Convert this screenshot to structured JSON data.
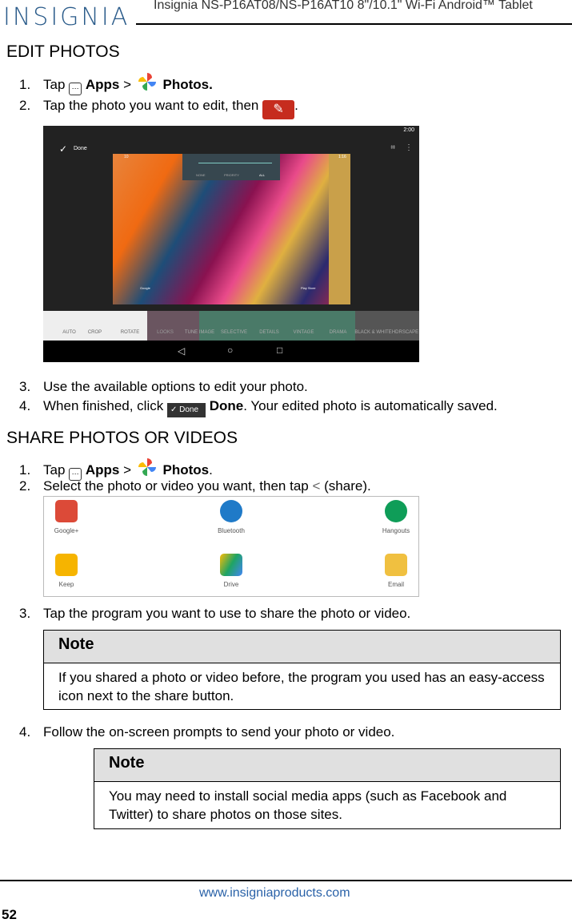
{
  "header": {
    "logo": "INSIGNIA",
    "title": "Insignia  NS-P16AT08/NS-P16AT10  8\"/10.1\" Wi-Fi Android™ Tablet"
  },
  "edit": {
    "heading": "EDIT PHOTOS",
    "steps": [
      {
        "n": "1.",
        "pre": "Tap",
        "apps": "Apps",
        ">": ">",
        "photos": "Photos."
      },
      {
        "n": "2.",
        "text": "Tap the photo you want to edit, then",
        "end": "."
      },
      {
        "n": "3.",
        "text": "Use the available options to edit your photo."
      },
      {
        "n": "4.",
        "pre": "When finished, click",
        "button": "Done",
        "bold": "Done",
        "post": ". Your edited photo is automatically saved."
      }
    ],
    "screenshot": {
      "done": "Done",
      "time": "2:00",
      "left_time": "10",
      "right_time": "1:16",
      "sound": [
        "NONE",
        "PRIORITY",
        "ALL"
      ],
      "google": "Google",
      "play": "Play Store",
      "tools": [
        "AUTO",
        "CROP",
        "ROTATE",
        "LOOKS",
        "TUNE IMAGE",
        "SELECTIVE",
        "DETAILS",
        "VINTAGE",
        "DRAMA",
        "BLACK & WHITE",
        "HDRSCAPE"
      ]
    }
  },
  "share": {
    "heading": "SHARE PHOTOS OR VIDEOS",
    "steps": [
      {
        "n": "1.",
        "pre": "Tap",
        "apps": "Apps",
        "photos": "Photos",
        "end": "."
      },
      {
        "n": "2.",
        "text": "Select the photo or video you want, then tap",
        "post": "(share)."
      },
      {
        "n": "3.",
        "text": "Tap the program you want to use to share the photo or video."
      },
      {
        "n": "4.",
        "text": "Follow the on-screen prompts to send your photo or video."
      }
    ],
    "apps": [
      {
        "label": "Google+",
        "color": "#dc4a38"
      },
      {
        "label": "Bluetooth",
        "color": "#1f7ac8"
      },
      {
        "label": "Hangouts",
        "color": "#0f9d58"
      },
      {
        "label": "Keep",
        "color": "#f6b400"
      },
      {
        "label": "Drive",
        "color": "#1fa463"
      },
      {
        "label": "Email",
        "color": "#f0c040"
      }
    ],
    "note1": {
      "title": "Note",
      "body": "If you shared a photo or video before, the program you used has an easy-access icon next to the share button."
    },
    "note2": {
      "title": "Note",
      "body": "You may need to install social media apps (such as Facebook and Twitter) to share photos on those sites."
    }
  },
  "footer": {
    "url": "www.insigniaproducts.com",
    "page": "52"
  }
}
